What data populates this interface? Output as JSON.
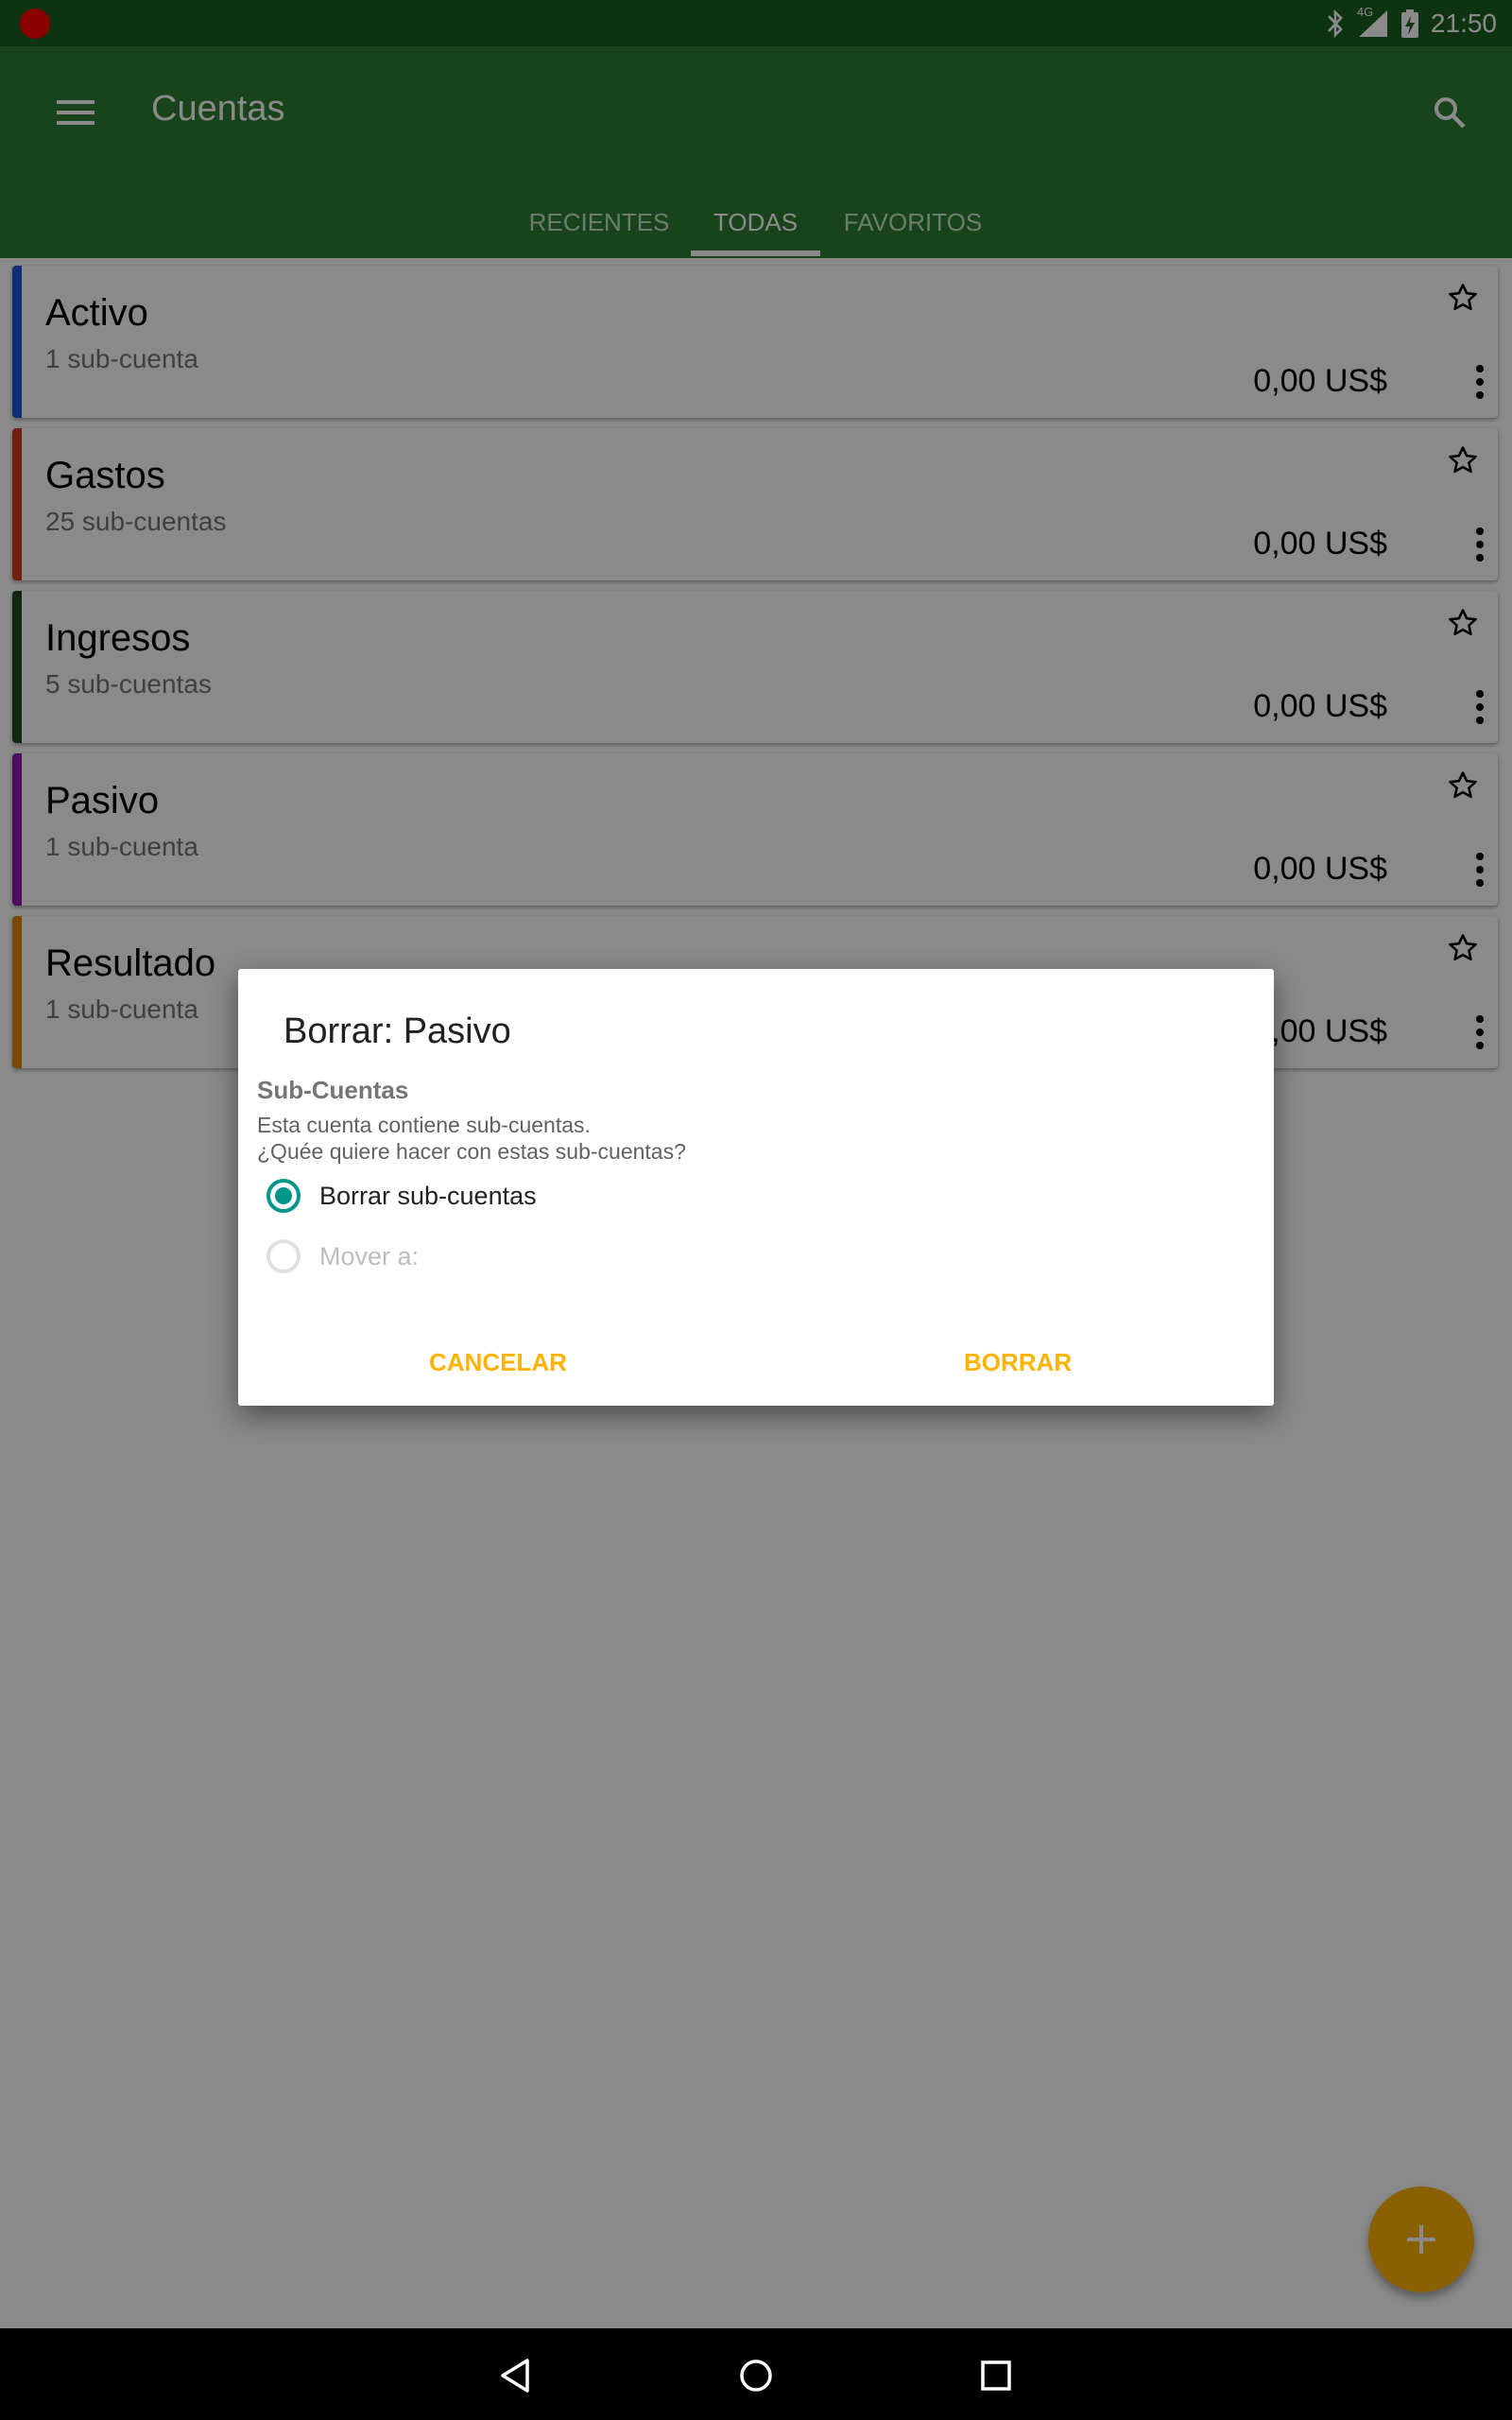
{
  "status_bar": {
    "time": "21:50",
    "network": "4G",
    "icons": [
      "record-icon",
      "bluetooth-icon",
      "signal-icon",
      "battery-charging-icon"
    ]
  },
  "app_bar": {
    "title": "Cuentas",
    "menu_icon": "menu-icon",
    "search_icon": "search-icon",
    "tabs": [
      {
        "label": "RECIENTES",
        "selected": false
      },
      {
        "label": "TODAS",
        "selected": true
      },
      {
        "label": "FAVORITOS",
        "selected": false
      }
    ]
  },
  "accounts": [
    {
      "name": "Activo",
      "subaccounts": "1 sub-cuenta",
      "balance": "0,00 US$",
      "color": "#1e56d8"
    },
    {
      "name": "Gastos",
      "subaccounts": "25 sub-cuentas",
      "balance": "0,00 US$",
      "color": "#d03a20"
    },
    {
      "name": "Ingresos",
      "subaccounts": "5 sub-cuentas",
      "balance": "0,00 US$",
      "color": "#1b4d1b"
    },
    {
      "name": "Pasivo",
      "subaccounts": "1 sub-cuenta",
      "balance": "0,00 US$",
      "color": "#8e1bb0"
    },
    {
      "name": "Resultado",
      "subaccounts": "1 sub-cuenta",
      "balance": "0,00 US$",
      "color": "#e08a00"
    }
  ],
  "dialog": {
    "title": "Borrar: Pasivo",
    "section_title": "Sub-Cuentas",
    "message_line1": "Esta cuenta contiene sub-cuentas.",
    "message_line2": "¿Quée quiere hacer con estas sub-cuentas?",
    "options": [
      {
        "label": "Borrar sub-cuentas",
        "selected": true,
        "enabled": true
      },
      {
        "label": "Mover a:",
        "selected": false,
        "enabled": false
      }
    ],
    "cancel_label": "CANCELAR",
    "delete_label": "BORRAR"
  },
  "fab": {
    "icon": "plus-icon"
  },
  "colors": {
    "primary": "#2e7d32",
    "primary_dark": "#1b5e20",
    "accent": "#ffb300",
    "radio": "#009688"
  }
}
